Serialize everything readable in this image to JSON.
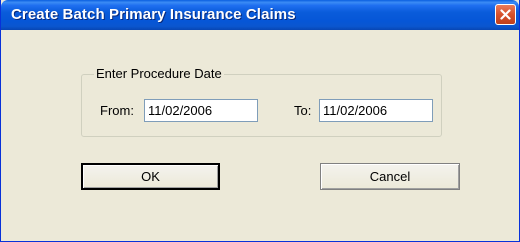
{
  "window": {
    "title": "Create Batch Primary Insurance Claims"
  },
  "group": {
    "label": "Enter Procedure Date"
  },
  "from": {
    "label": "From:",
    "value": "11/02/2006"
  },
  "to": {
    "label": "To:",
    "value": "11/02/2006"
  },
  "buttons": {
    "ok_label": "OK",
    "cancel_label": "Cancel"
  },
  "icons": {
    "close": "close-icon"
  },
  "colors": {
    "titlebar": "#0a56cf",
    "close_button": "#d6512c",
    "dialog_background": "#ece9d8"
  }
}
